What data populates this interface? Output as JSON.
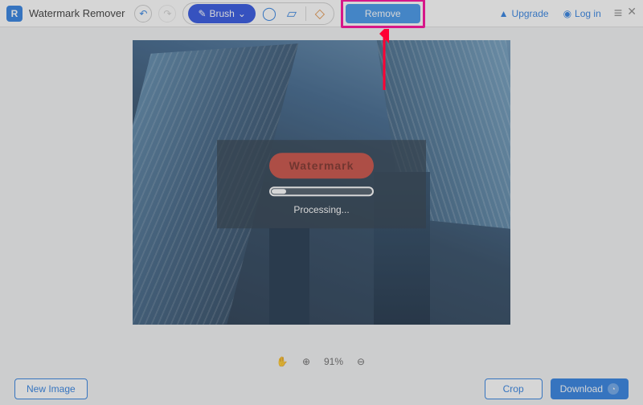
{
  "app": {
    "title": "Watermark Remover"
  },
  "toolbar": {
    "brush_label": "Brush",
    "remove_label": "Remove",
    "upgrade_label": "Upgrade",
    "login_label": "Log in"
  },
  "overlay": {
    "watermark_text": "Watermark",
    "processing_label": "Processing..."
  },
  "zoom": {
    "value": "91%"
  },
  "bottom": {
    "new_image_label": "New Image",
    "crop_label": "Crop",
    "download_label": "Download"
  },
  "icons": {
    "undo": "↶",
    "redo": "↷",
    "brush": "✎",
    "lasso": "◯",
    "polygon": "▱",
    "eraser": "◇",
    "hand": "✋",
    "zoom_in": "⊕",
    "zoom_out": "⊖",
    "upgrade": "▲",
    "user": "◉",
    "menu": "≡",
    "close": "✕",
    "chevron": "⌄",
    "clock": "◔"
  }
}
